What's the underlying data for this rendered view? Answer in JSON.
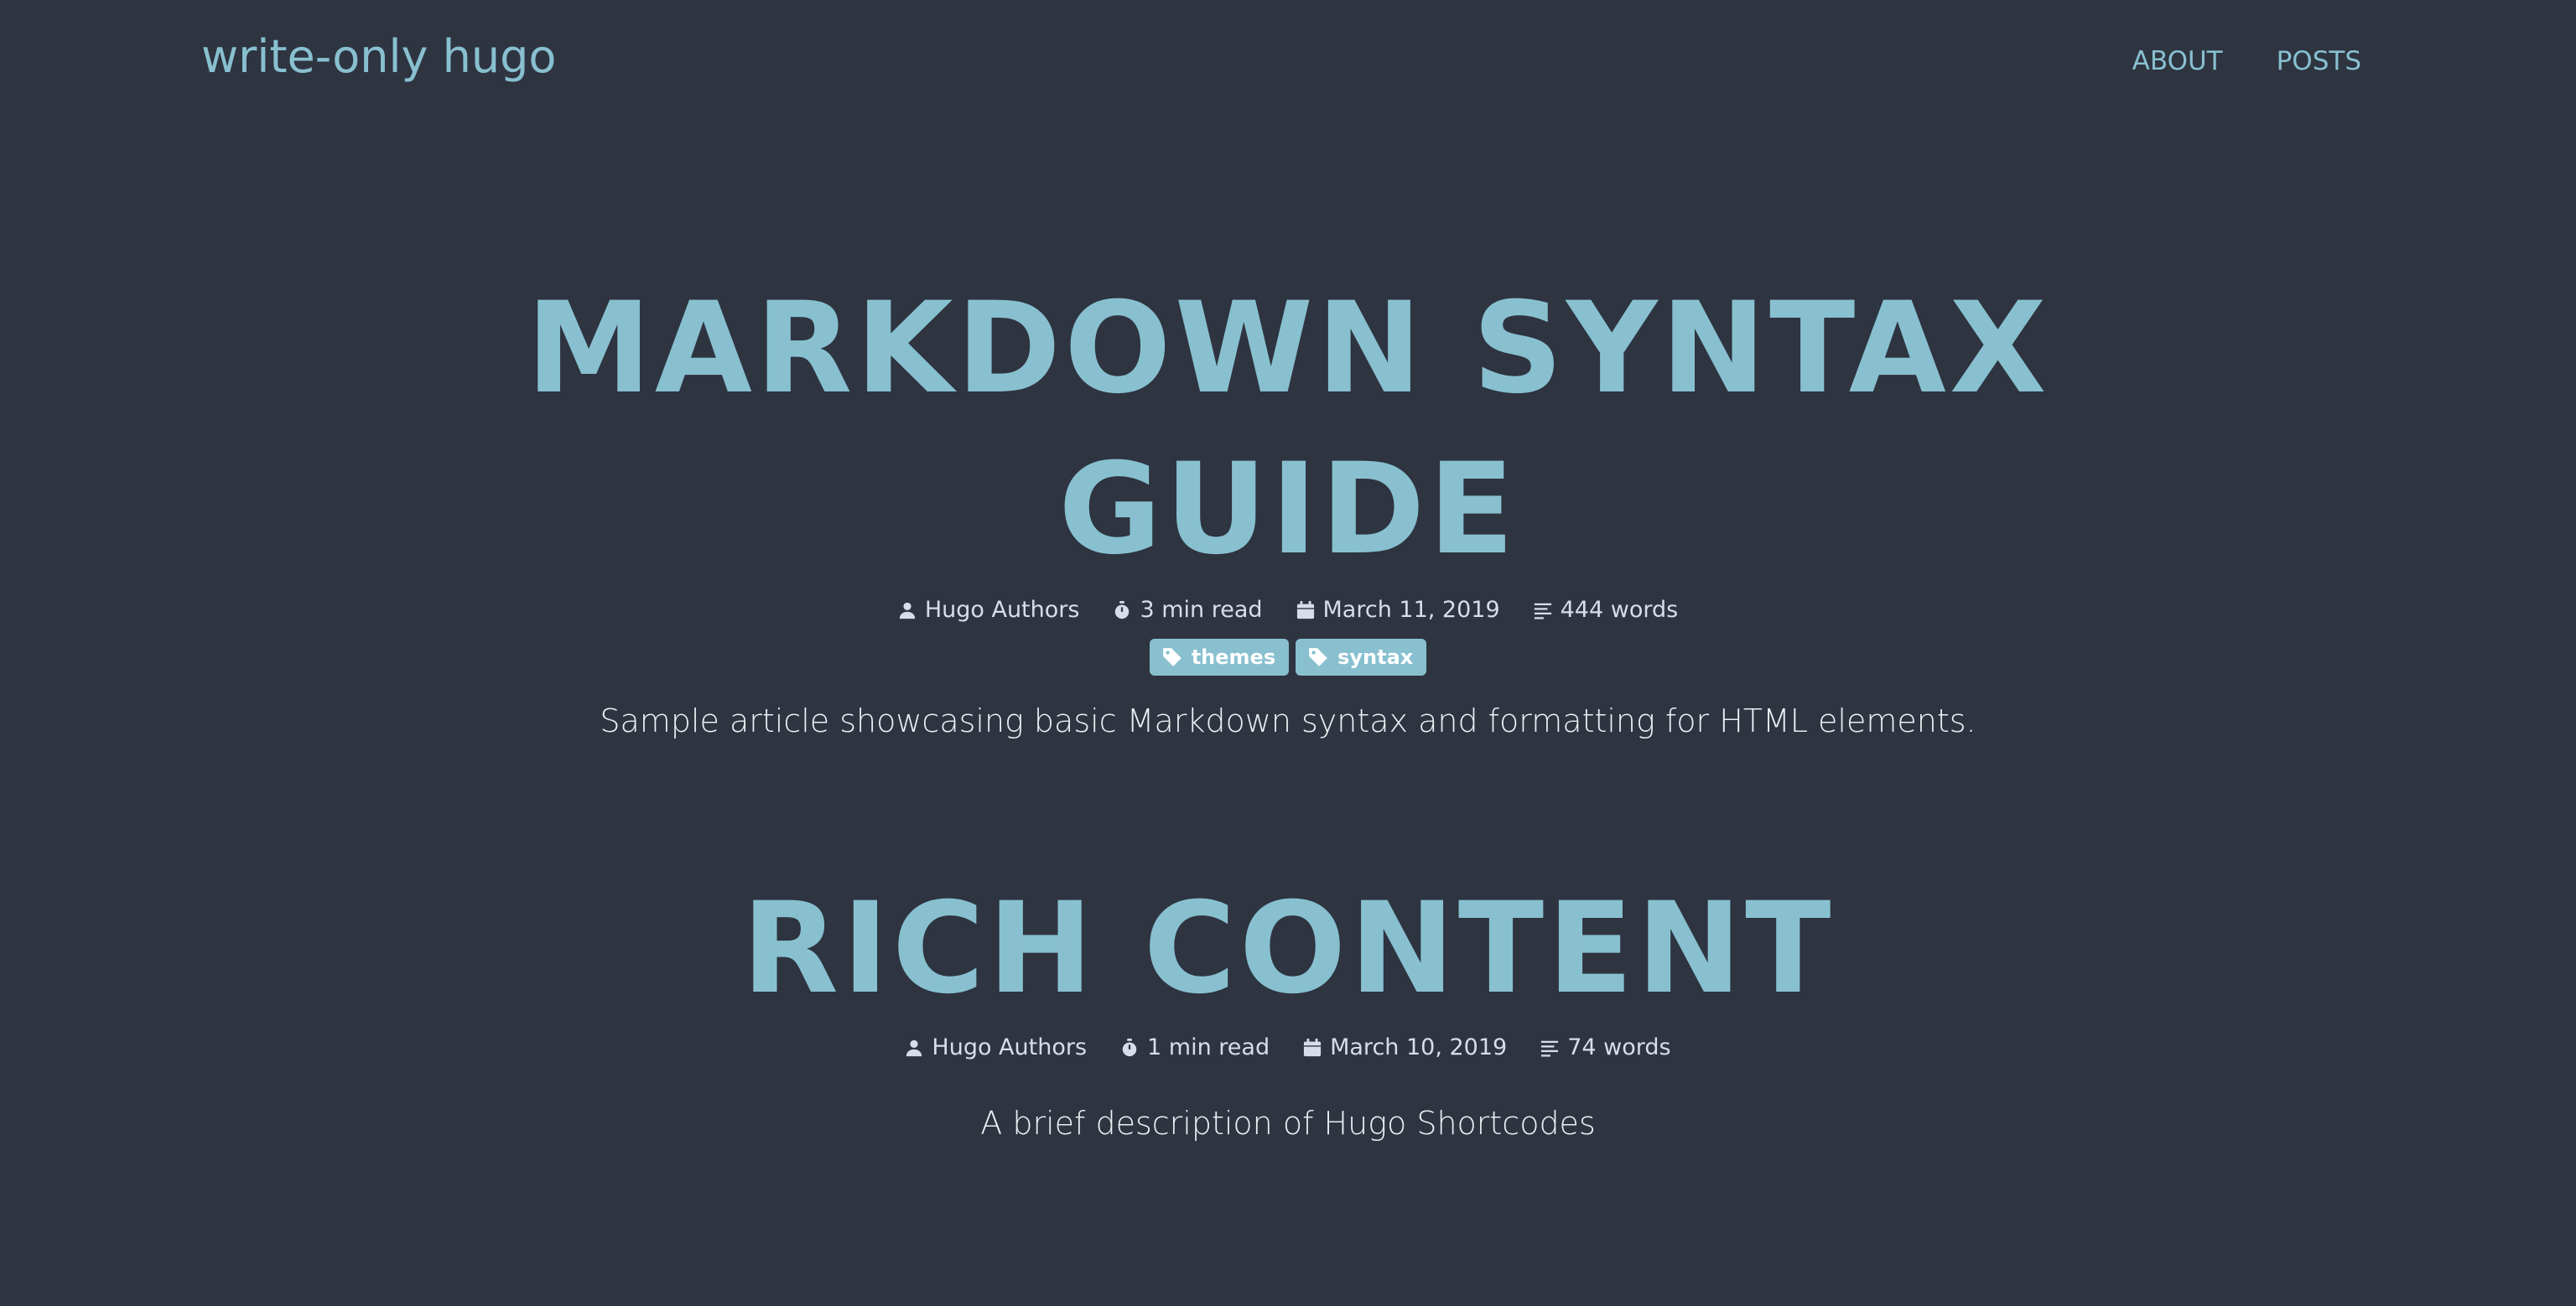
{
  "site": {
    "title": "write-only hugo"
  },
  "nav": {
    "items": [
      {
        "label": "ABOUT"
      },
      {
        "label": "POSTS"
      }
    ]
  },
  "posts": [
    {
      "title": "MARKDOWN SYNTAX GUIDE",
      "author": "Hugo Authors",
      "read_time": "3 min read",
      "date": "March 11, 2019",
      "words": "444 words",
      "tags": [
        "themes",
        "syntax"
      ],
      "description": "Sample article showcasing basic Markdown syntax and formatting for HTML elements."
    },
    {
      "title": "RICH CONTENT",
      "author": "Hugo Authors",
      "read_time": "1 min read",
      "date": "March 10, 2019",
      "words": "74 words",
      "tags": [],
      "description": "A brief description of Hugo Shortcodes"
    }
  ],
  "colors": {
    "background": "#2e3440",
    "accent": "#88c0d0",
    "text": "#d8dee9",
    "tag_text": "#ffffff"
  },
  "icons": {
    "author": "person-icon",
    "read_time": "stopwatch-icon",
    "date": "calendar-icon",
    "words": "text-lines-icon",
    "tag": "tag-icon"
  }
}
